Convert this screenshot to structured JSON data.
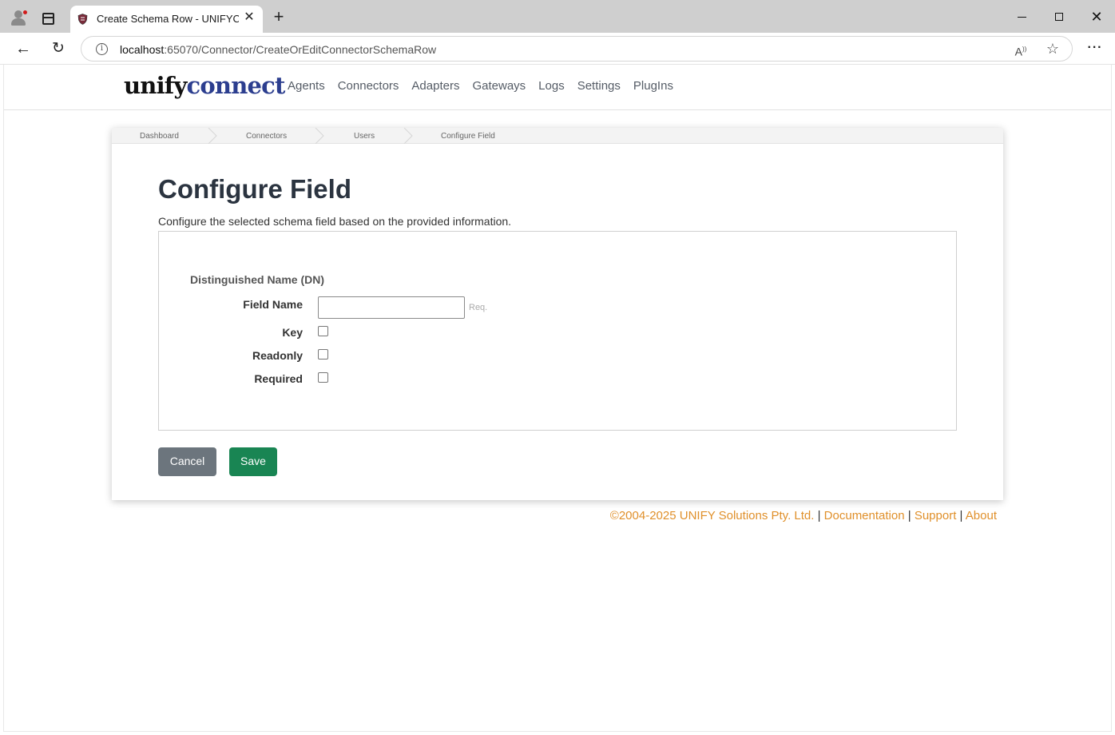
{
  "browser": {
    "tab_title": "Create Schema Row - UNIFYConnect",
    "url_host": "localhost",
    "url_rest": ":65070/Connector/CreateOrEditConnectorSchemaRow",
    "icons": [
      "profile-icon",
      "tabs-icon",
      "close-icon",
      "plus-icon",
      "back-icon",
      "reload-icon",
      "info-icon",
      "read-aloud-icon",
      "favorite-star-icon",
      "more-icon"
    ]
  },
  "header": {
    "logo_part1": "unify",
    "logo_part2": "connect",
    "nav": [
      "Agents",
      "Connectors",
      "Adapters",
      "Gateways",
      "Logs",
      "Settings",
      "PlugIns"
    ]
  },
  "breadcrumb": [
    "Dashboard",
    "Connectors",
    "Users",
    "Configure Field"
  ],
  "page": {
    "title": "Configure Field",
    "description": "Configure the selected schema field based on the provided information."
  },
  "form": {
    "section_title": "Distinguished Name (DN)",
    "field_name_label": "Field Name",
    "field_name_value": "",
    "required_hint": "Req.",
    "key_label": "Key",
    "key_checked": false,
    "readonly_label": "Readonly",
    "readonly_checked": false,
    "required_label": "Required",
    "required_checked": false
  },
  "actions": {
    "cancel_label": "Cancel",
    "save_label": "Save"
  },
  "footer": {
    "copyright": "©2004-2025 UNIFY Solutions Pty. Ltd.",
    "separator": "|",
    "links": [
      "Documentation",
      "Support",
      "About"
    ]
  },
  "colors": {
    "brand_dark": "#2c3e8f",
    "cancel_button": "#6c757d",
    "save_button": "#198553",
    "footer_link": "#e0902b"
  }
}
